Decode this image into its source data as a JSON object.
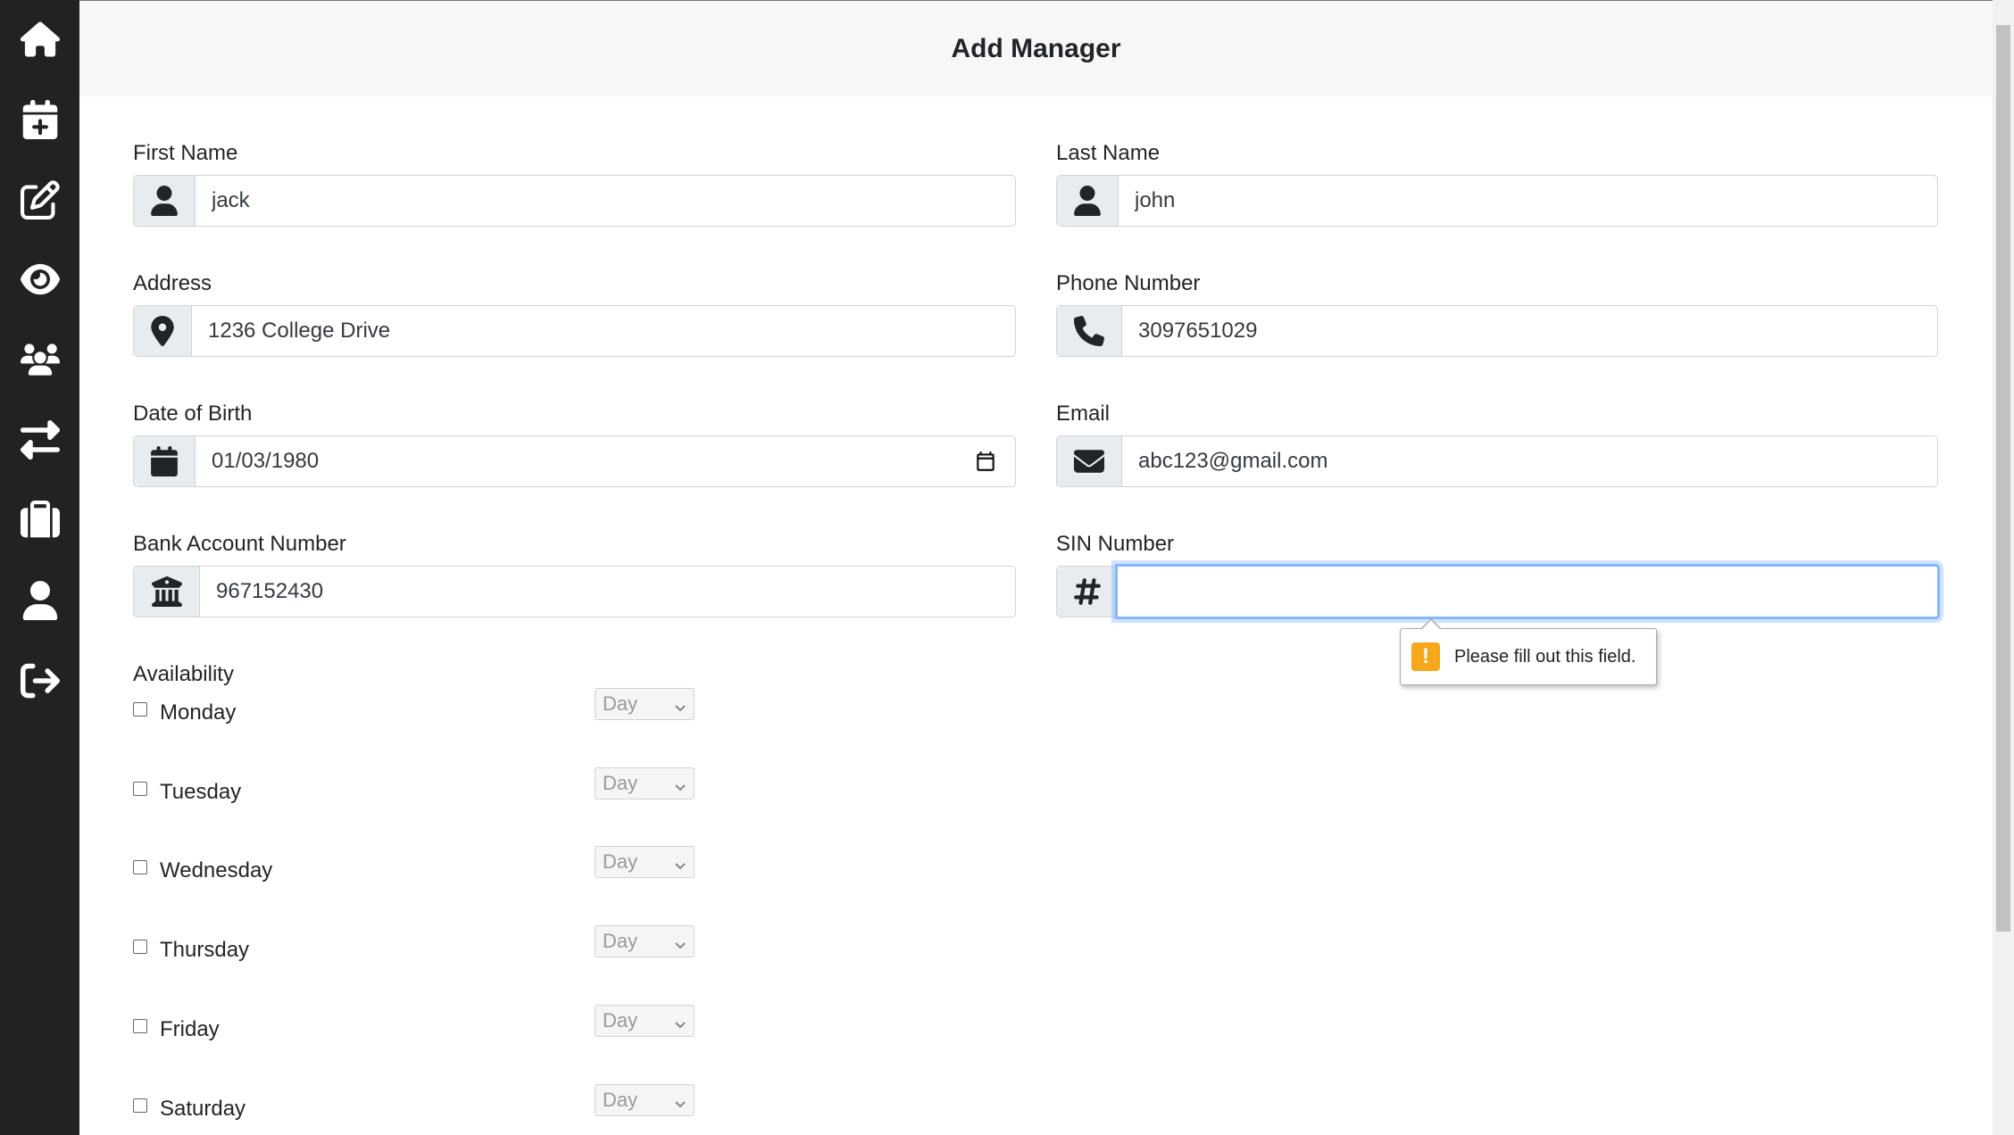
{
  "header": {
    "title": "Add Manager"
  },
  "sidebar": {
    "items": [
      {
        "icon": "home-icon"
      },
      {
        "icon": "calendar-plus-icon"
      },
      {
        "icon": "edit-icon"
      },
      {
        "icon": "eye-icon"
      },
      {
        "icon": "users-icon"
      },
      {
        "icon": "exchange-icon"
      },
      {
        "icon": "briefcase-icon"
      },
      {
        "icon": "user-icon"
      },
      {
        "icon": "sign-out-icon"
      }
    ]
  },
  "form": {
    "first_name": {
      "label": "First Name",
      "value": "jack",
      "icon": "user-icon"
    },
    "last_name": {
      "label": "Last Name",
      "value": "john",
      "icon": "user-icon"
    },
    "address": {
      "label": "Address",
      "value": "1236 College Drive",
      "icon": "map-marker-icon"
    },
    "phone": {
      "label": "Phone Number",
      "value": "3097651029",
      "icon": "phone-icon"
    },
    "dob": {
      "label": "Date of Birth",
      "value": "01/03/1980",
      "icon": "calendar-icon"
    },
    "email": {
      "label": "Email",
      "value": "abc123@gmail.com",
      "icon": "envelope-icon"
    },
    "bank": {
      "label": "Bank Account Number",
      "value": "967152430",
      "icon": "bank-icon"
    },
    "sin": {
      "label": "SIN Number",
      "value": "",
      "icon": "hash-icon"
    }
  },
  "validation": {
    "message": "Please fill out this field."
  },
  "availability": {
    "label": "Availability",
    "days": [
      {
        "name": "Monday",
        "select": "Day"
      },
      {
        "name": "Tuesday",
        "select": "Day"
      },
      {
        "name": "Wednesday",
        "select": "Day"
      },
      {
        "name": "Thursday",
        "select": "Day"
      },
      {
        "name": "Friday",
        "select": "Day"
      },
      {
        "name": "Saturday",
        "select": "Day"
      }
    ]
  },
  "colors": {
    "sidebar": "#222222",
    "header_bg": "#f7f7f7",
    "focus": "#86b7fe",
    "warning": "#f7a71a"
  }
}
